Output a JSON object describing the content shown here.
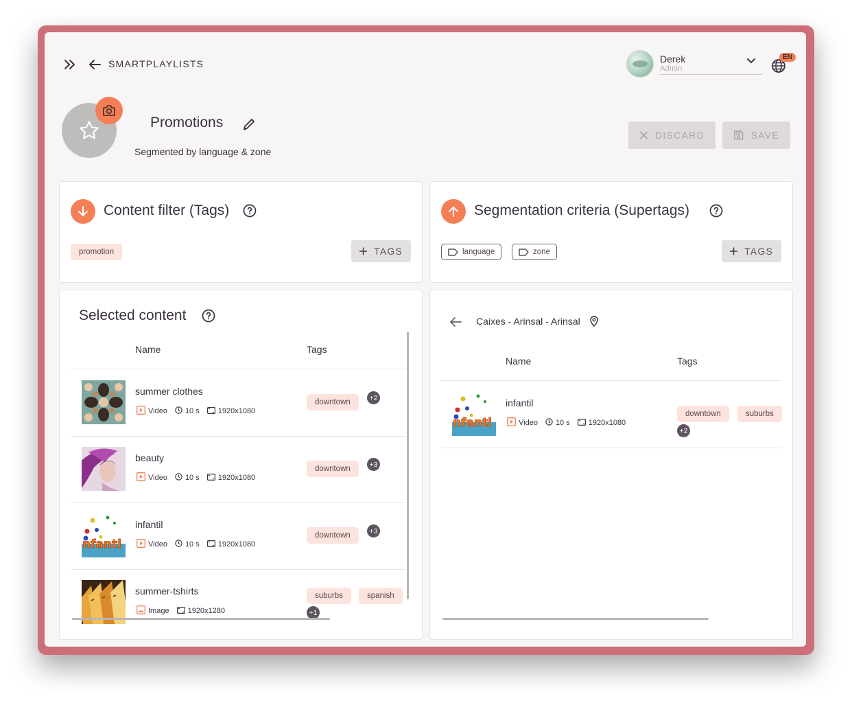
{
  "header": {
    "breadcrumb": "SMARTPLAYLISTS",
    "user": {
      "name": "Derek",
      "role": "Admin"
    },
    "language": "EN"
  },
  "playlist": {
    "title": "Promotions",
    "subtitle": "Segmented by language & zone",
    "discard_label": "DISCARD",
    "save_label": "SAVE"
  },
  "content_filter": {
    "title": "Content filter (Tags)",
    "tags": [
      "promotion"
    ],
    "add_label": "TAGS"
  },
  "segmentation": {
    "title": "Segmentation criteria (Supertags)",
    "tags": [
      "language",
      "zone"
    ],
    "add_label": "TAGS"
  },
  "selected_content": {
    "title": "Selected content",
    "columns": [
      "Name",
      "Tags"
    ],
    "rows": [
      {
        "name": "summer clothes",
        "type": "Video",
        "duration": "10 s",
        "resolution": "1920x1080",
        "tags": [
          "downtown"
        ],
        "more": "+2",
        "thumb": "pattern"
      },
      {
        "name": "beauty",
        "type": "Video",
        "duration": "10 s",
        "resolution": "1920x1080",
        "tags": [
          "downtown"
        ],
        "more": "+3",
        "thumb": "portrait"
      },
      {
        "name": "infantil",
        "type": "Video",
        "duration": "10 s",
        "resolution": "1920x1080",
        "tags": [
          "downtown"
        ],
        "more": "+3",
        "thumb": "infantil"
      },
      {
        "name": "summer-tshirts",
        "type": "Image",
        "duration": "",
        "resolution": "1920x1280",
        "tags": [
          "suburbs",
          "spanish"
        ],
        "more": "+1",
        "thumb": "shirts"
      }
    ]
  },
  "segment_preview": {
    "location": "Caixes - Arinsal - Arinsal",
    "columns": [
      "Name",
      "Tags"
    ],
    "rows": [
      {
        "name": "infantil",
        "type": "Video",
        "duration": "10 s",
        "resolution": "1920x1080",
        "tags": [
          "downtown",
          "suburbs"
        ],
        "more": "+2",
        "thumb": "infantil"
      }
    ]
  },
  "colors": {
    "accent": "#f47f56",
    "chip": "#fde3dd",
    "frame": "#cc6f78"
  }
}
